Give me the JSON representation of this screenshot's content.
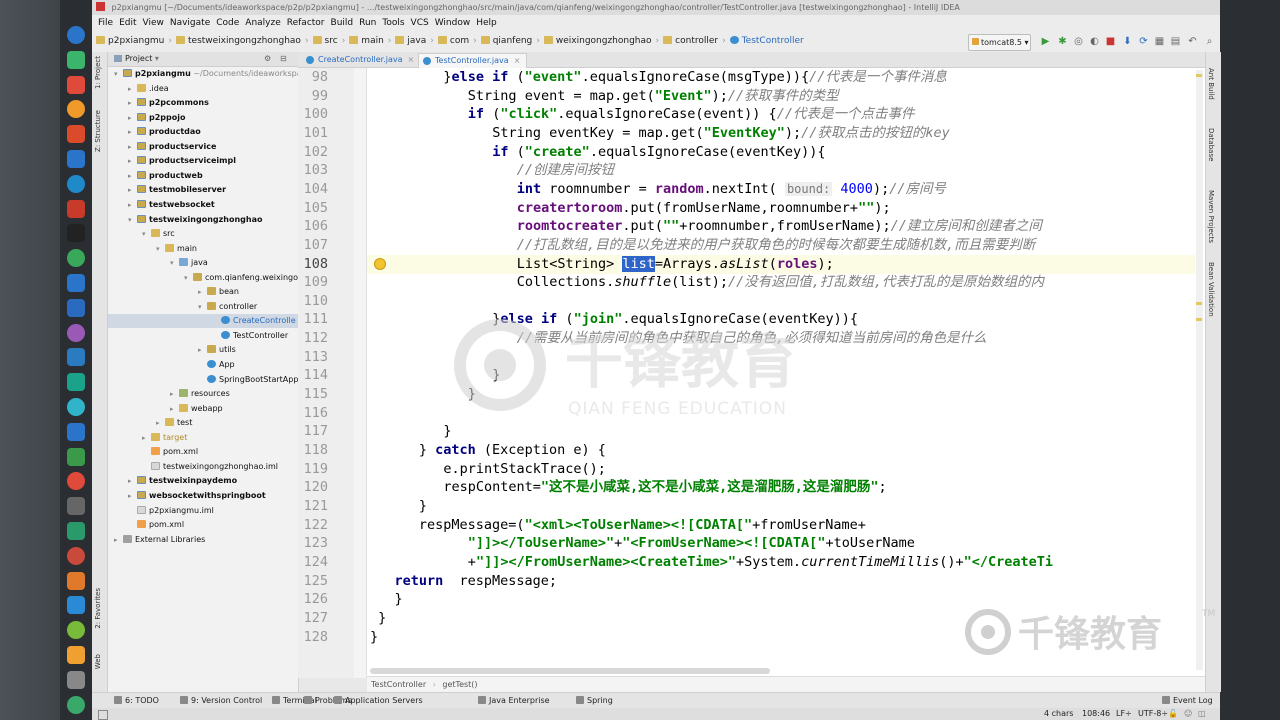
{
  "window": {
    "title": "p2pxiangmu [~/Documents/ideaworkspace/p2p/p2pxiangmu] - .../testweixingongzhonghao/src/main/java/com/qianfeng/weixingongzhonghao/controller/TestController.java [testweixingongzhonghao] - IntelliJ IDEA"
  },
  "menu": [
    "File",
    "Edit",
    "View",
    "Navigate",
    "Code",
    "Analyze",
    "Refactor",
    "Build",
    "Run",
    "Tools",
    "VCS",
    "Window",
    "Help"
  ],
  "breadcrumbs": [
    "p2pxiangmu",
    "testweixingongzhonghao",
    "src",
    "main",
    "java",
    "com",
    "qianfeng",
    "weixingongzhonghao",
    "controller",
    "TestController"
  ],
  "run_config": "tomcat8.5",
  "left_strip_tabs": [
    "1: Project",
    "Z: Structure",
    "2: Favorites",
    "Web"
  ],
  "right_strip_tabs": [
    "Ant Build",
    "Database",
    "Maven Projects",
    "Bean Validation"
  ],
  "project_panel": {
    "title": "Project",
    "tree": [
      {
        "label": "p2pxiangmu",
        "suffix": " ~/Documents/ideaworkspa",
        "depth": 0,
        "icon": "module",
        "bold": true,
        "expanded": true
      },
      {
        "label": ".idea",
        "depth": 1,
        "icon": "folder"
      },
      {
        "label": "p2pcommons",
        "depth": 1,
        "icon": "module",
        "bold": true
      },
      {
        "label": "p2ppojo",
        "depth": 1,
        "icon": "module",
        "bold": true
      },
      {
        "label": "productdao",
        "depth": 1,
        "icon": "module",
        "bold": true
      },
      {
        "label": "productservice",
        "depth": 1,
        "icon": "module",
        "bold": true
      },
      {
        "label": "productserviceimpl",
        "depth": 1,
        "icon": "module",
        "bold": true
      },
      {
        "label": "productweb",
        "depth": 1,
        "icon": "module",
        "bold": true
      },
      {
        "label": "testmobileserver",
        "depth": 1,
        "icon": "module",
        "bold": true
      },
      {
        "label": "testwebsocket",
        "depth": 1,
        "icon": "module",
        "bold": true
      },
      {
        "label": "testweixingongzhonghao",
        "depth": 1,
        "icon": "module",
        "bold": true,
        "expanded": true
      },
      {
        "label": "src",
        "depth": 2,
        "icon": "folder",
        "expanded": true
      },
      {
        "label": "main",
        "depth": 3,
        "icon": "folder",
        "expanded": true
      },
      {
        "label": "java",
        "depth": 4,
        "icon": "src",
        "expanded": true
      },
      {
        "label": "com.qianfeng.weixingo",
        "depth": 5,
        "icon": "package",
        "expanded": true
      },
      {
        "label": "bean",
        "depth": 6,
        "icon": "package"
      },
      {
        "label": "controller",
        "depth": 6,
        "icon": "package",
        "expanded": true
      },
      {
        "label": "CreateControlle",
        "depth": 7,
        "icon": "class",
        "selected": true
      },
      {
        "label": "TestController",
        "depth": 7,
        "icon": "class"
      },
      {
        "label": "utils",
        "depth": 6,
        "icon": "package"
      },
      {
        "label": "App",
        "depth": 6,
        "icon": "class"
      },
      {
        "label": "SpringBootStartApp",
        "depth": 6,
        "icon": "class"
      },
      {
        "label": "resources",
        "depth": 4,
        "icon": "res"
      },
      {
        "label": "webapp",
        "depth": 4,
        "icon": "folder"
      },
      {
        "label": "test",
        "depth": 3,
        "icon": "folder"
      },
      {
        "label": "target",
        "depth": 2,
        "icon": "folder",
        "muted": true
      },
      {
        "label": "pom.xml",
        "depth": 2,
        "icon": "xml"
      },
      {
        "label": "testweixingongzhonghao.iml",
        "depth": 2,
        "icon": "file"
      },
      {
        "label": "testweixinpaydemo",
        "depth": 1,
        "icon": "module",
        "bold": true
      },
      {
        "label": "websocketwithspringboot",
        "depth": 1,
        "icon": "module",
        "bold": true
      },
      {
        "label": "p2pxiangmu.iml",
        "depth": 1,
        "icon": "file"
      },
      {
        "label": "pom.xml",
        "depth": 1,
        "icon": "xml"
      },
      {
        "label": "External Libraries",
        "depth": 0,
        "icon": "lib"
      }
    ]
  },
  "editor": {
    "tabs": [
      {
        "label": "CreateController.java",
        "active": false
      },
      {
        "label": "TestController.java",
        "active": true
      }
    ],
    "current_line": 108,
    "lines": [
      {
        "n": 98,
        "ind": 9,
        "t": [
          [
            "}",
            "p"
          ],
          [
            "else if",
            "kw"
          ],
          [
            " (",
            "p"
          ],
          [
            "\"event\"",
            "st"
          ],
          [
            ".equalsIgnoreCase(msgType)){",
            "p"
          ],
          [
            "//代表是一个事件消息",
            "cm"
          ]
        ]
      },
      {
        "n": 99,
        "ind": 12,
        "t": [
          [
            "String event = map.get(",
            "p"
          ],
          [
            "\"Event\"",
            "st"
          ],
          [
            ");",
            "p"
          ],
          [
            "//获取事件的类型",
            "cm"
          ]
        ]
      },
      {
        "n": 100,
        "ind": 12,
        "t": [
          [
            "if",
            "kw"
          ],
          [
            " (",
            "p"
          ],
          [
            "\"click\"",
            "st"
          ],
          [
            ".equalsIgnoreCase(event)) {",
            "p"
          ],
          [
            "//代表是一个点击事件",
            "cm"
          ]
        ]
      },
      {
        "n": 101,
        "ind": 15,
        "t": [
          [
            "String eventKey = map.get(",
            "p"
          ],
          [
            "\"EventKey\"",
            "st"
          ],
          [
            ");",
            "p"
          ],
          [
            "//获取点击的按钮的key",
            "cm"
          ]
        ]
      },
      {
        "n": 102,
        "ind": 15,
        "t": [
          [
            "if",
            "kw"
          ],
          [
            " (",
            "p"
          ],
          [
            "\"create\"",
            "st"
          ],
          [
            ".equalsIgnoreCase(eventKey)){",
            "p"
          ]
        ]
      },
      {
        "n": 103,
        "ind": 18,
        "t": [
          [
            "//创建房间按钮",
            "cm"
          ]
        ]
      },
      {
        "n": 104,
        "ind": 18,
        "t": [
          [
            "int",
            "kw"
          ],
          [
            " roomnumber = ",
            "p"
          ],
          [
            "random",
            "fd"
          ],
          [
            ".nextInt( ",
            "p"
          ],
          [
            "bound:",
            "hint"
          ],
          [
            " 4000",
            "nm"
          ],
          [
            ");",
            "p"
          ],
          [
            "//房间号",
            "cm"
          ]
        ]
      },
      {
        "n": 105,
        "ind": 18,
        "t": [
          [
            "creatertoroom",
            "fd"
          ],
          [
            ".put(fromUserName,roomnumber+",
            "p"
          ],
          [
            "\"\"",
            "st"
          ],
          [
            ");",
            "p"
          ]
        ]
      },
      {
        "n": 106,
        "ind": 18,
        "t": [
          [
            "roomtocreater",
            "fd"
          ],
          [
            ".put(",
            "p"
          ],
          [
            "\"\"",
            "st"
          ],
          [
            "+roomnumber,fromUserName);",
            "p"
          ],
          [
            "//建立房间和创建者之间",
            "cm"
          ]
        ]
      },
      {
        "n": 107,
        "ind": 18,
        "t": [
          [
            "//打乱数组,目的是以免进来的用户获取角色的时候每次都要生成随机数,而且需要判断",
            "cm"
          ]
        ]
      },
      {
        "n": 108,
        "ind": 18,
        "t": [
          [
            "List<String> ",
            "p"
          ],
          [
            "list",
            "sel"
          ],
          [
            "=Arrays.",
            "p"
          ],
          [
            "asList",
            "it"
          ],
          [
            "(",
            "p"
          ],
          [
            "roles",
            "fd"
          ],
          [
            ");",
            "p"
          ]
        ]
      },
      {
        "n": 109,
        "ind": 18,
        "t": [
          [
            "Collections.",
            "p"
          ],
          [
            "shuffle",
            "it"
          ],
          [
            "(list);",
            "p"
          ],
          [
            "//没有返回值,打乱数组,代表打乱的是原始数组的内",
            "cm"
          ]
        ]
      },
      {
        "n": 110,
        "ind": 0,
        "t": []
      },
      {
        "n": 111,
        "ind": 15,
        "t": [
          [
            "}",
            "p"
          ],
          [
            "else if",
            "kw"
          ],
          [
            " (",
            "p"
          ],
          [
            "\"join\"",
            "st"
          ],
          [
            ".equalsIgnoreCase(eventKey)){",
            "p"
          ]
        ]
      },
      {
        "n": 112,
        "ind": 18,
        "t": [
          [
            "//需要从当前房间的角色中获取自己的角色,必须得知道当前房间的角色是什么",
            "cm"
          ]
        ]
      },
      {
        "n": 113,
        "ind": 0,
        "t": []
      },
      {
        "n": 114,
        "ind": 15,
        "t": [
          [
            "}",
            "p"
          ]
        ]
      },
      {
        "n": 115,
        "ind": 12,
        "t": [
          [
            "}",
            "p"
          ]
        ]
      },
      {
        "n": 116,
        "ind": 0,
        "t": []
      },
      {
        "n": 117,
        "ind": 9,
        "t": [
          [
            "}",
            "p"
          ]
        ]
      },
      {
        "n": 118,
        "ind": 6,
        "t": [
          [
            "} ",
            "p"
          ],
          [
            "catch",
            "kw"
          ],
          [
            " (Exception e) {",
            "p"
          ]
        ]
      },
      {
        "n": 119,
        "ind": 9,
        "t": [
          [
            "e.printStackTrace();",
            "p"
          ]
        ]
      },
      {
        "n": 120,
        "ind": 9,
        "t": [
          [
            "respContent=",
            "p"
          ],
          [
            "\"这不是小咸菜,这不是小咸菜,这是溜肥肠,这是溜肥肠\"",
            "st"
          ],
          [
            ";",
            "p"
          ]
        ]
      },
      {
        "n": 121,
        "ind": 6,
        "t": [
          [
            "}",
            "p"
          ]
        ]
      },
      {
        "n": 122,
        "ind": 6,
        "t": [
          [
            "respMessage=(",
            "p"
          ],
          [
            "\"<xml><ToUserName><![CDATA[\"",
            "st"
          ],
          [
            "+fromUserName+",
            "p"
          ]
        ]
      },
      {
        "n": 123,
        "ind": 12,
        "t": [
          [
            "\"]]></ToUserName>\"",
            "st"
          ],
          [
            "+",
            "p"
          ],
          [
            "\"<FromUserName><![CDATA[\"",
            "st"
          ],
          [
            "+toUserName",
            "p"
          ]
        ]
      },
      {
        "n": 124,
        "ind": 12,
        "t": [
          [
            "+",
            "p"
          ],
          [
            "\"]]></FromUserName><CreateTime>\"",
            "st"
          ],
          [
            "+System.",
            "p"
          ],
          [
            "currentTimeMillis",
            "it"
          ],
          [
            "()+",
            "p"
          ],
          [
            "\"</CreateTi",
            "st"
          ]
        ]
      },
      {
        "n": 125,
        "ind": 3,
        "t": [
          [
            "return",
            "kw"
          ],
          [
            "  respMessage;",
            "p"
          ]
        ]
      },
      {
        "n": 126,
        "ind": 3,
        "t": [
          [
            "}",
            "p"
          ]
        ]
      },
      {
        "n": 127,
        "ind": 1,
        "t": [
          [
            "}",
            "p"
          ]
        ]
      },
      {
        "n": 128,
        "ind": 0,
        "t": [
          [
            "}",
            "p"
          ]
        ]
      }
    ],
    "breadcrumb": [
      "TestController",
      "getTest()"
    ]
  },
  "tool_windows": [
    "6: TODO",
    "9: Version Control",
    "Terminal",
    "Problems",
    "Application Servers",
    "Java Enterprise",
    "Spring",
    "Event Log"
  ],
  "status": {
    "selection": "4 chars",
    "caret": "108:46",
    "line_sep": "LF÷",
    "encoding": "UTF-8÷"
  },
  "watermark": {
    "brand": "千锋教育",
    "sub": "QIAN FENG EDUCATION",
    "tm": "TM"
  },
  "colors": {
    "keyword": "#000080",
    "string": "#008000",
    "comment": "#808080",
    "field": "#660e7a",
    "selection": "#2f65ca",
    "current_line": "#fcfbe3"
  }
}
